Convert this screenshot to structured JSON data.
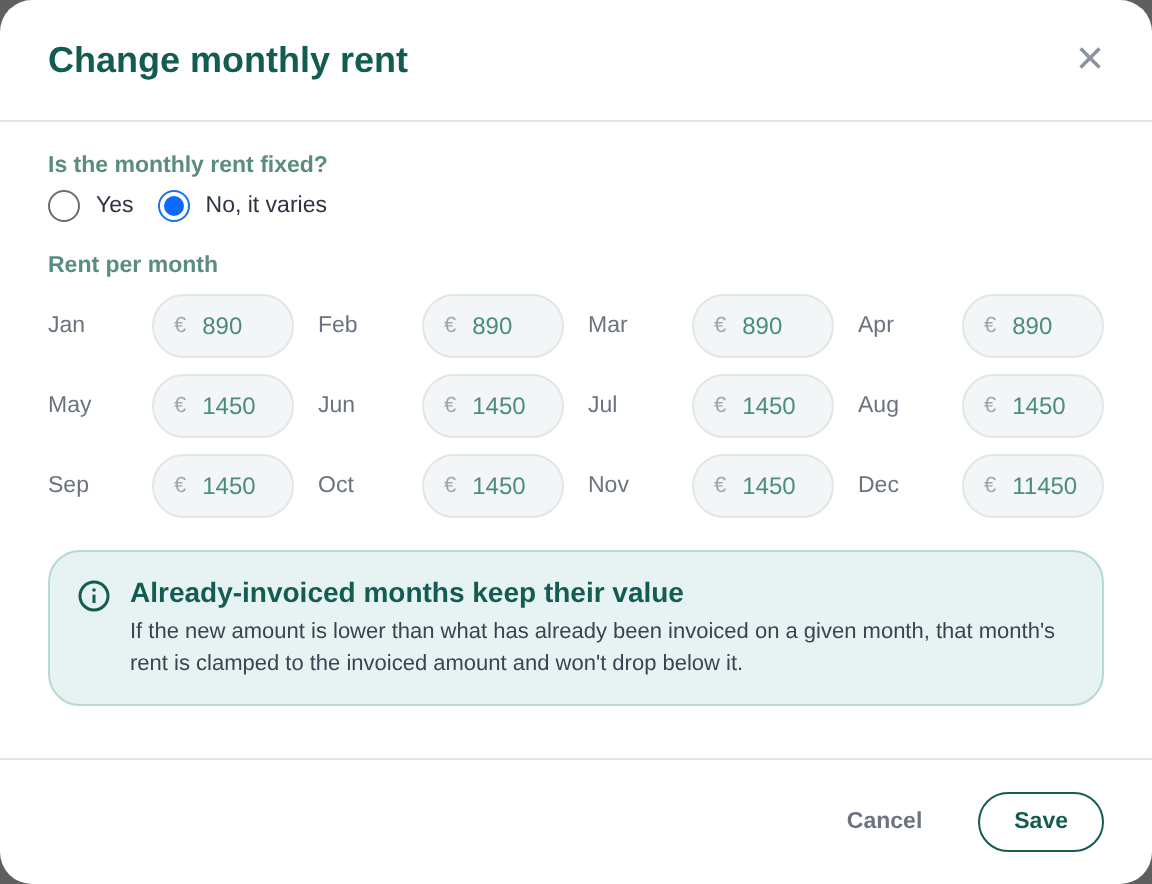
{
  "dialog": {
    "title": "Change monthly rent",
    "close": "×"
  },
  "fixed_question": {
    "label": "Is the monthly rent fixed?",
    "options": [
      {
        "label": "Yes",
        "selected": false
      },
      {
        "label": "No, it varies",
        "selected": true
      }
    ]
  },
  "rent_section": {
    "label": "Rent per month",
    "months": [
      {
        "month": "Jan",
        "currency": "€",
        "value": "890"
      },
      {
        "month": "Feb",
        "currency": "€",
        "value": "890"
      },
      {
        "month": "Mar",
        "currency": "€",
        "value": "890"
      },
      {
        "month": "Apr",
        "currency": "€",
        "value": "890"
      },
      {
        "month": "May",
        "currency": "€",
        "value": "1450"
      },
      {
        "month": "Jun",
        "currency": "€",
        "value": "1450"
      },
      {
        "month": "Jul",
        "currency": "€",
        "value": "1450"
      },
      {
        "month": "Aug",
        "currency": "€",
        "value": "1450"
      },
      {
        "month": "Sep",
        "currency": "€",
        "value": "1450"
      },
      {
        "month": "Oct",
        "currency": "€",
        "value": "1450"
      },
      {
        "month": "Nov",
        "currency": "€",
        "value": "1450"
      },
      {
        "month": "Dec",
        "currency": "€",
        "value": "11450"
      }
    ]
  },
  "notice": {
    "title": "Already-invoiced months keep their value",
    "text": "If the new amount is lower than what has already been invoiced on a given month, that month's rent is clamped to the invoiced amount and won't drop below it."
  },
  "buttons": [
    {
      "label": "Cancel",
      "kind": "text"
    },
    {
      "label": "Save",
      "kind": "outline"
    }
  ]
}
